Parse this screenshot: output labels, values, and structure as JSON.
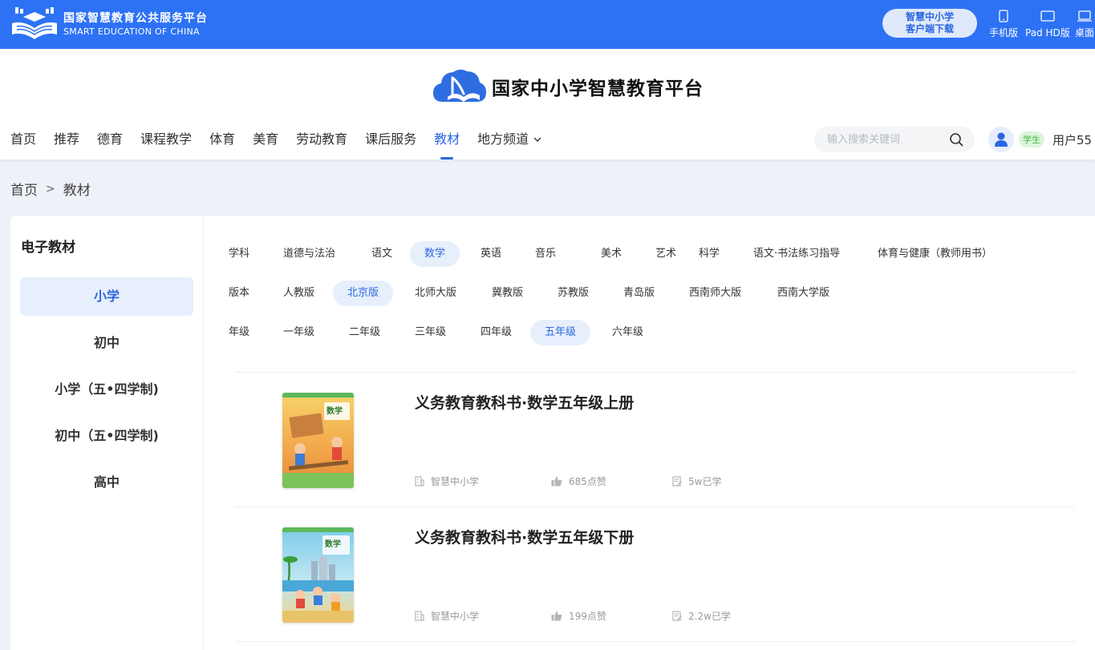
{
  "topbar": {
    "brand_cn": "国家智慧教育公共服务平台",
    "brand_en": "SMART EDUCATION OF CHINA",
    "download_line1": "智慧中小学",
    "download_line2": "客户端下载",
    "devices": [
      {
        "label": "手机版",
        "icon": "phone-icon"
      },
      {
        "label": "Pad HD版",
        "icon": "tablet-icon"
      },
      {
        "label": "桌面",
        "icon": "laptop-icon"
      }
    ]
  },
  "header": {
    "platform_name": "国家中小学智慧教育平台",
    "nav": [
      "首页",
      "推荐",
      "德育",
      "课程教学",
      "体育",
      "美育",
      "劳动教育",
      "课后服务",
      "教材",
      "地方频道"
    ],
    "nav_active": "教材",
    "search_placeholder": "输入搜索关键词",
    "user_role": "学生",
    "user_name": "用户55"
  },
  "breadcrumb": {
    "home": "首页",
    "sep": ">",
    "current": "教材"
  },
  "sidebar": {
    "title": "电子教材",
    "items": [
      "小学",
      "初中",
      "小学（五•四学制)",
      "初中（五•四学制)",
      "高中"
    ],
    "active": "小学"
  },
  "filters": {
    "subject": {
      "label": "学科",
      "items": [
        "道德与法治",
        "语文",
        "数学",
        "英语",
        "音乐",
        "美术",
        "艺术",
        "科学",
        "语文·书法练习指导",
        "体育与健康（教师用书）"
      ],
      "active": "数学"
    },
    "edition": {
      "label": "版本",
      "items": [
        "人教版",
        "北京版",
        "北师大版",
        "冀教版",
        "苏教版",
        "青岛版",
        "西南师大版",
        "西南大学版"
      ],
      "active": "北京版"
    },
    "grade": {
      "label": "年级",
      "items": [
        "一年级",
        "二年级",
        "三年级",
        "四年级",
        "五年级",
        "六年级"
      ],
      "active": "五年级"
    }
  },
  "books": [
    {
      "title": "义务教育教科书·数学五年级上册",
      "cover_text": "数学",
      "source": "智慧中小学",
      "likes": "685点赞",
      "learned": "5w已学"
    },
    {
      "title": "义务教育教科书·数学五年级下册",
      "cover_text": "数学",
      "source": "智慧中小学",
      "likes": "199点赞",
      "learned": "2.2w已学"
    }
  ],
  "colors": {
    "topbar": "#2d72f5",
    "accent": "#2b66e0",
    "active_bg": "#e7effc",
    "page_bg": "#eef1f7"
  }
}
